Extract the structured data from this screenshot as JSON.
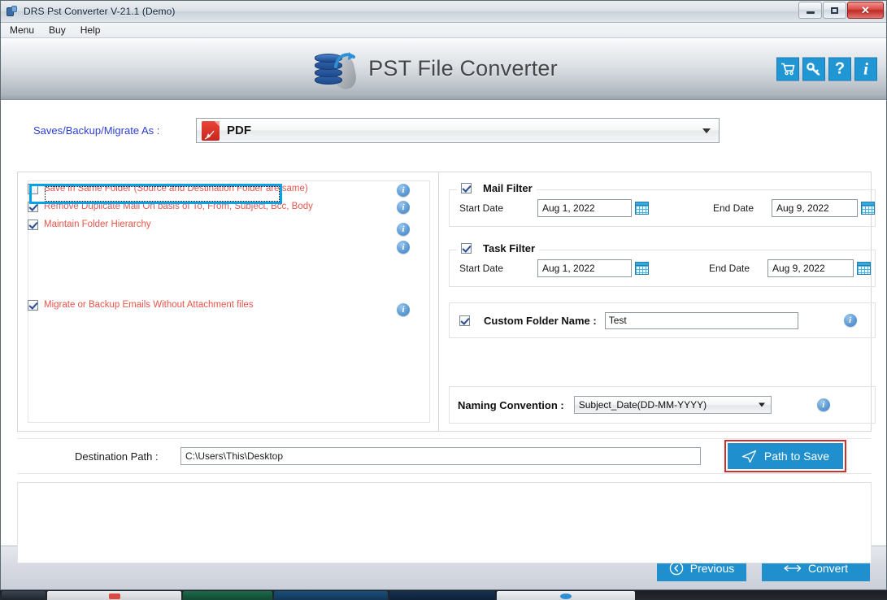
{
  "window": {
    "title": "DRS Pst Converter V-21.1 (Demo)",
    "icon": "app-icon",
    "controls": {
      "minimize": "minimize",
      "maximize": "maximize",
      "close": "✕"
    }
  },
  "menubar": {
    "items": [
      {
        "label": "Menu"
      },
      {
        "label": "Buy"
      },
      {
        "label": "Help"
      }
    ]
  },
  "banner": {
    "title": "PST File Converter",
    "logo": "database-convert-logo",
    "icons": [
      {
        "name": "cart-icon",
        "glyph": "cart"
      },
      {
        "name": "key-icon",
        "glyph": "key"
      },
      {
        "name": "help-icon",
        "glyph": "?"
      },
      {
        "name": "info-icon",
        "glyph": "i"
      }
    ]
  },
  "format": {
    "label": "Saves/Backup/Migrate As :",
    "selected": "PDF",
    "icon": "pdf-file-icon",
    "mark": "PDF"
  },
  "left_panel": {
    "options": [
      {
        "label": "Save in Same Folder (Source and Destination Folder are same)",
        "checked": false,
        "focused": true
      },
      {
        "label": "Remove Duplicate Mail On basis of To, From, Subject, Bcc, Body",
        "checked": true
      },
      {
        "label": "Maintain Folder Hierarchy",
        "checked": true
      },
      {
        "label": "Migrate or Backup Emails Without Attachment files",
        "checked": true
      }
    ],
    "info_glyph": "i",
    "info_count": 5
  },
  "mail_filter": {
    "title": "Mail Filter",
    "checked": true,
    "start_label": "Start Date",
    "start_value": "Aug 1, 2022",
    "end_label": "End Date",
    "end_value": "Aug 9, 2022",
    "calendar_icon": "calendar-icon"
  },
  "task_filter": {
    "title": "Task Filter",
    "checked": true,
    "start_label": "Start Date",
    "start_value": "Aug 1, 2022",
    "end_label": "End Date",
    "end_value": "Aug 9, 2022",
    "calendar_icon": "calendar-icon"
  },
  "custom_folder": {
    "title": "Custom Folder Name :",
    "checked": true,
    "value": "Test",
    "info_glyph": "i"
  },
  "naming_convention": {
    "title": "Naming Convention :",
    "selected": "Subject_Date(DD-MM-YYYY)",
    "info_glyph": "i"
  },
  "destination": {
    "label": "Destination Path :",
    "value": "C:\\Users\\This\\Desktop",
    "button_label": "Path to Save",
    "button_icon": "paper-plane-icon",
    "button_color": "#1f8fce",
    "highlight_color": "#d0312a"
  },
  "footer": {
    "previous_label": "Previous",
    "previous_icon": "chevron-left-circle-icon",
    "convert_label": "Convert",
    "convert_icon": "exchange-arrows-icon",
    "button_color": "#1f8fce"
  },
  "colors": {
    "accent_blue": "#1f8fce",
    "label_blue": "#2b3fd4",
    "option_red": "#e8544a",
    "focus_cyan": "#00a2e8"
  }
}
